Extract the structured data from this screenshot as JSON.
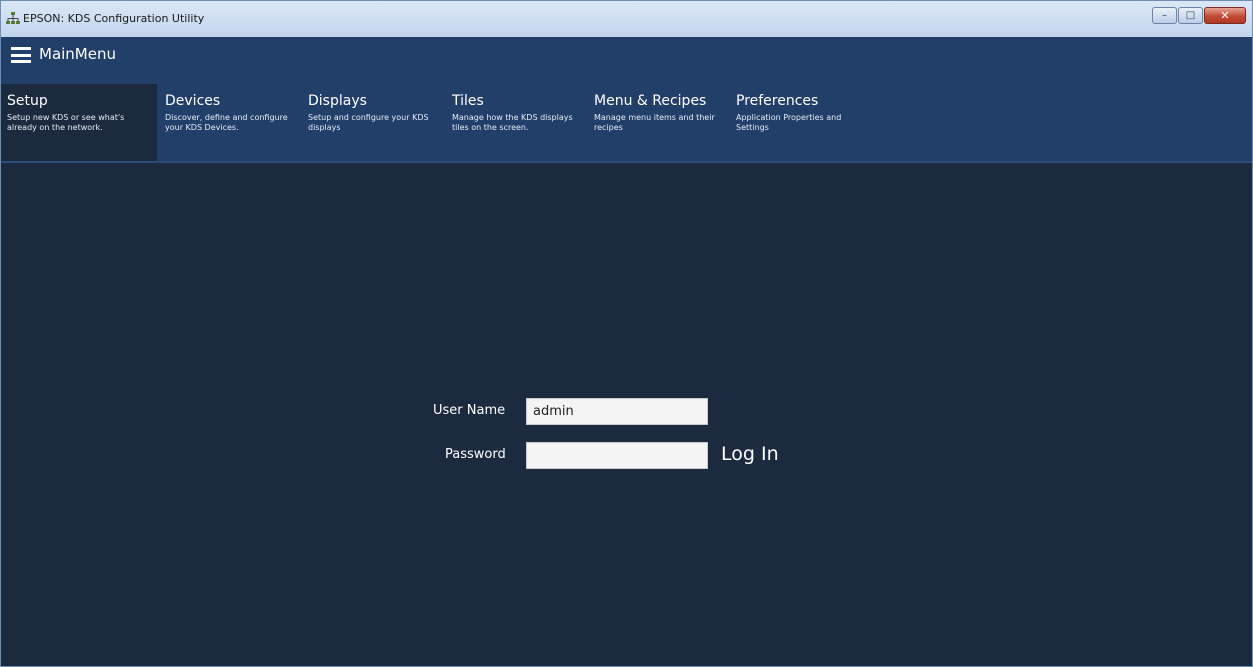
{
  "window": {
    "title": "EPSON: KDS Configuration Utility",
    "controls": {
      "minimize": "–",
      "maximize": "□",
      "close": "✕"
    }
  },
  "header": {
    "title": "MainMenu",
    "menu_icon": "hamburger-icon"
  },
  "nav": {
    "items": [
      {
        "label": "Setup",
        "description": "Setup new KDS or see what's already on the network.",
        "active": true
      },
      {
        "label": "Devices",
        "description": "Discover, define and configure your KDS Devices.",
        "active": false
      },
      {
        "label": "Displays",
        "description": "Setup and configure your KDS displays",
        "active": false
      },
      {
        "label": "Tiles",
        "description": "Manage how the KDS displays tiles on the screen.",
        "active": false
      },
      {
        "label": "Menu & Recipes",
        "description": "Manage menu items and their recipes",
        "active": false
      },
      {
        "label": "Preferences",
        "description": "Application Properties and Settings",
        "active": false
      }
    ]
  },
  "login": {
    "username_label": "User Name",
    "username_value": "admin",
    "password_label": "Password",
    "password_value": "",
    "login_button": "Log In"
  },
  "colors": {
    "background": "#1c2a40",
    "nav_background": "#223f6a",
    "active_tab": "#1c2a40"
  }
}
